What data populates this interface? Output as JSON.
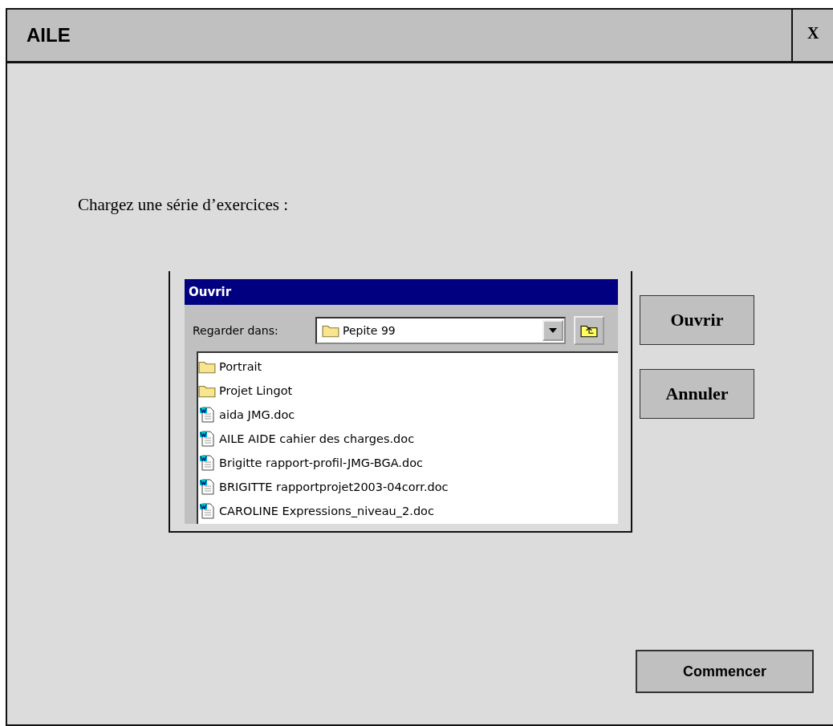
{
  "window": {
    "title": "AILE",
    "close_label": "X"
  },
  "prompt": "Chargez une série d’exercices :",
  "open_dialog": {
    "title": "Ouvrir",
    "look_in_label": "Regarder dans:",
    "look_in_value": "Pepite 99",
    "items": [
      {
        "name": "Portrait",
        "kind": "folder"
      },
      {
        "name": "Projet Lingot",
        "kind": "folder"
      },
      {
        "name": "aida JMG.doc",
        "kind": "doc"
      },
      {
        "name": "AILE AIDE cahier des charges.doc",
        "kind": "doc"
      },
      {
        "name": "Brigitte rapport-profil-JMG-BGA.doc",
        "kind": "doc"
      },
      {
        "name": "BRIGITTE rapportprojet2003-04corr.doc",
        "kind": "doc"
      },
      {
        "name": "CAROLINE Expressions_niveau_2.doc",
        "kind": "doc"
      }
    ]
  },
  "side_buttons": [
    "Ouvrir",
    "Annuler"
  ],
  "start_button": "Commencer"
}
